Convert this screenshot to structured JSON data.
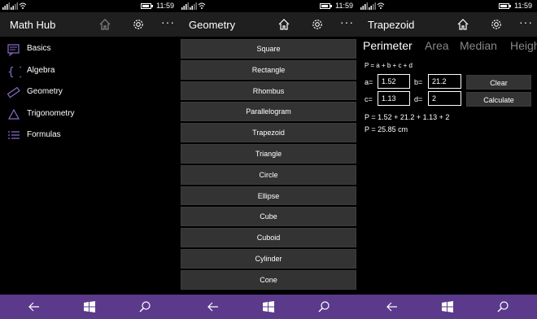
{
  "status": {
    "time": "11:59"
  },
  "screen1": {
    "title": "Math Hub",
    "menu": [
      {
        "label": "Basics",
        "icon": "notes-icon"
      },
      {
        "label": "Algebra",
        "icon": "braces-icon"
      },
      {
        "label": "Geometry",
        "icon": "ruler-icon"
      },
      {
        "label": "Trigonometry",
        "icon": "triangle-icon"
      },
      {
        "label": "Formulas",
        "icon": "list-icon"
      }
    ]
  },
  "screen2": {
    "title": "Geometry",
    "shapes": [
      "Square",
      "Rectangle",
      "Rhombus",
      "Parallelogram",
      "Trapezoid",
      "Triangle",
      "Circle",
      "Ellipse",
      "Cube",
      "Cuboid",
      "Cylinder",
      "Cone"
    ]
  },
  "screen3": {
    "title": "Trapezoid",
    "tabs": [
      "Perimeter",
      "Area",
      "Median",
      "Height"
    ],
    "active_tab": "Perimeter",
    "formula": "P = a + b + c + d",
    "a_label": "a=",
    "a_value": "1.52",
    "b_label": "b=",
    "b_value": "21.2",
    "c_label": "c=",
    "c_value": "1.13",
    "d_label": "d=",
    "d_value": "2",
    "clear_label": "Clear",
    "calculate_label": "Calculate",
    "expression": "P = 1.52 + 21.2 + 1.13 + 2",
    "result": "P = 25.85 cm"
  },
  "colors": {
    "accent": "#5b3a8c",
    "icon_accent": "#8a6cc9",
    "header_bg": "#1f1f1f",
    "button_bg": "#333333"
  }
}
